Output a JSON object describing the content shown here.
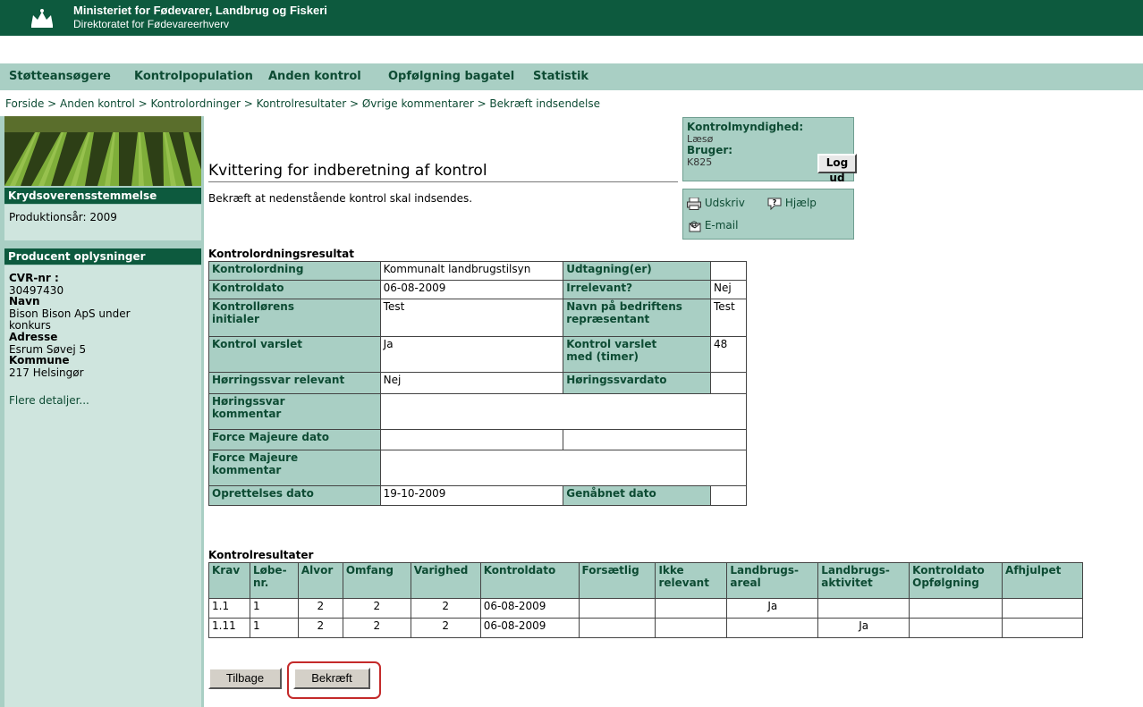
{
  "header": {
    "ministry": "Ministeriet for Fødevarer, Landbrug og Fiskeri",
    "directorate": "Direktoratet for Fødevareerhverv"
  },
  "nav": [
    "Støtteansøgere",
    "Kontrolpopulation",
    "Anden kontrol",
    "Opfølgning bagatel",
    "Statistik"
  ],
  "breadcrumb": "Forside > Anden kontrol > Kontrolordninger > Kontrolresultater > Øvrige kommentarer > Bekræft indsendelse",
  "sidebar": {
    "section1_title": "Krydsoverensstemmelse",
    "production_year": "Produktionsår: 2009",
    "section2_title": "Producent oplysninger",
    "cvr_label": "CVR-nr :",
    "cvr_value": "30497430",
    "name_label": "Navn",
    "name_value_line1": "Bison Bison ApS under",
    "name_value_line2": "konkurs",
    "address_label": "Adresse",
    "address_value": "Esrum Søvej 5",
    "municipality_label": "Kommune",
    "municipality_value": "217 Helsingør",
    "more_details": "Flere detaljer..."
  },
  "page": {
    "title": "Kvittering for indberetning af kontrol",
    "subtitle": "Bekræft at nedenstående kontrol skal indsendes."
  },
  "auth": {
    "authority_label": "Kontrolmyndighed:",
    "authority_value": "Læsø",
    "user_label": "Bruger:",
    "user_value": "K825",
    "logout_label": "Log ud"
  },
  "tools": {
    "print": "Udskriv",
    "help": "Hjælp",
    "email": "E-mail"
  },
  "result": {
    "section_title": "Kontrolordningsresultat",
    "kontrolordning_label": "Kontrolordning",
    "kontrolordning_value": "Kommunalt landbrugstilsyn",
    "udtagning_label": "Udtagning(er)",
    "udtagning_value": "",
    "kontroldato_label": "Kontroldato",
    "kontroldato_value": "06-08-2009",
    "irrelevant_label": "Irrelevant?",
    "irrelevant_value": "Nej",
    "initialer_label_1": "Kontrollørens",
    "initialer_label_2": "initialer",
    "initialer_value": "Test",
    "repr_label_1": "Navn på bedriftens",
    "repr_label_2": "repræsentant",
    "repr_value": "Test",
    "varslet_label": "Kontrol varslet",
    "varslet_value": "Ja",
    "varslet_med_label_1": "Kontrol varslet",
    "varslet_med_label_2": "med (timer)",
    "varslet_med_value": "48",
    "horingssvar_rel_label": "Hørringssvar relevant",
    "horingssvar_rel_value": "Nej",
    "horingssvardato_label": "Høringssvardato",
    "horingssvar_komm_label_1": "Høringssvar",
    "horingssvar_komm_label_2": "kommentar",
    "force_dato_label": "Force Majeure dato",
    "force_komm_label_1": "Force Majeure",
    "force_komm_label_2": "kommentar",
    "oprettelse_label": "Oprettelses dato",
    "oprettelse_value": "19-10-2009",
    "genabnet_label": "Genåbnet dato"
  },
  "kontrolresultater": {
    "section_title": "Kontrolresultater",
    "headers": [
      [
        "Krav"
      ],
      [
        "Løbe-",
        "nr."
      ],
      [
        "Alvor"
      ],
      [
        "Omfang"
      ],
      [
        "Varighed"
      ],
      [
        "Kontroldato"
      ],
      [
        "Forsætlig"
      ],
      [
        "Ikke",
        "relevant"
      ],
      [
        "Landbrugs-",
        "areal"
      ],
      [
        "Landbrugs-",
        "aktivitet"
      ],
      [
        "Kontroldato",
        "Opfølgning"
      ],
      [
        "Afhjulpet"
      ]
    ],
    "rows": [
      [
        "1.1",
        "1",
        "2",
        "2",
        "2",
        "06-08-2009",
        "",
        "",
        "Ja",
        "",
        "",
        ""
      ],
      [
        "1.11",
        "1",
        "2",
        "2",
        "2",
        "06-08-2009",
        "",
        "",
        "",
        "Ja",
        "",
        ""
      ]
    ]
  },
  "buttons": {
    "back": "Tilbage",
    "confirm": "Bekræft"
  }
}
